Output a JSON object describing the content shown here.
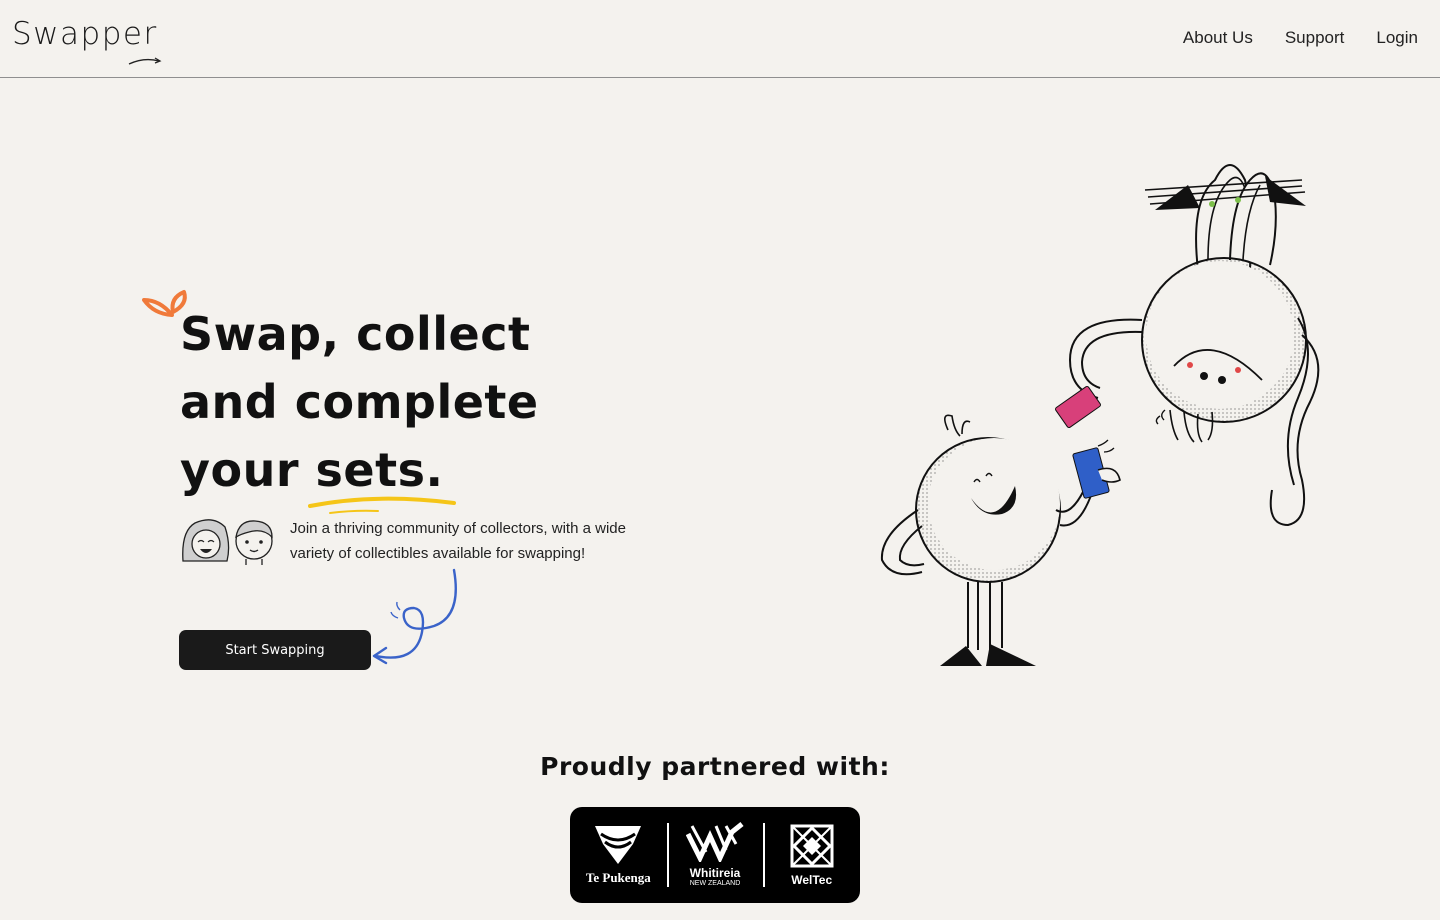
{
  "brand": {
    "name": "Swapper"
  },
  "nav": {
    "links": [
      {
        "label": "About Us"
      },
      {
        "label": "Support"
      },
      {
        "label": "Login"
      }
    ]
  },
  "hero": {
    "title_lines": [
      "Swap, collect",
      "and complete",
      "your sets."
    ],
    "description": "Join a thriving community of collectors, with a wide variety of collectibles available for swapping!",
    "cta_label": "Start Swapping"
  },
  "partners": {
    "title": "Proudly partnered with:",
    "items": [
      {
        "name": "Te Pukenga",
        "icon": "te-pukenga-logo"
      },
      {
        "name": "Whitireia",
        "sub": "NEW ZEALAND",
        "icon": "whitireia-logo"
      },
      {
        "name": "WelTec",
        "icon": "weltec-logo"
      }
    ]
  },
  "colors": {
    "background": "#f4f2ee",
    "button": "#1a1a1a",
    "accent_orange": "#f07a3a",
    "accent_yellow": "#f5c518",
    "accent_blue": "#3a63c9",
    "card_pink": "#d8407a",
    "card_blue": "#2f5fc8"
  }
}
